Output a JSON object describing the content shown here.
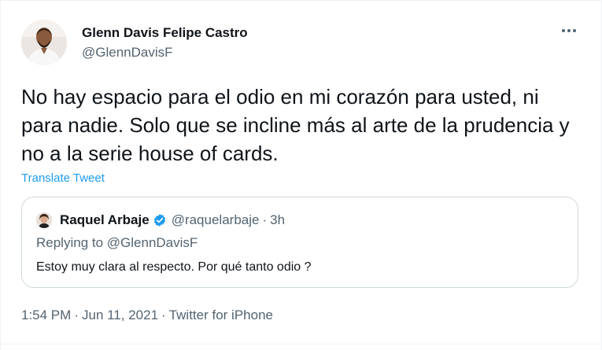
{
  "tweet": {
    "author_name": "Glenn Davis Felipe Castro",
    "author_handle": "@GlennDavisF",
    "more_icon": "more-dots-icon",
    "text": "No hay espacio para el odio en mi corazón para usted, ni para nadie. Solo que se incline más al arte de la prudencia y no a la serie house of cards.",
    "translate_label": "Translate Tweet",
    "time": "1:54 PM",
    "separator": "·",
    "date": "Jun 11, 2021",
    "source": "Twitter for iPhone"
  },
  "quote": {
    "author_name": "Raquel Arbaje",
    "verified_icon": "verified-badge-icon",
    "author_handle": "@raquelarbaje",
    "separator": "·",
    "time_ago": "3h",
    "replying_prefix": "Replying to ",
    "replying_to": "@GlennDavisF",
    "text": "Estoy muy clara al respecto. Por qué tanto odio ?"
  },
  "colors": {
    "text_primary": "#0f1419",
    "text_secondary": "#536471",
    "link_blue": "#1d9bf0",
    "border": "#cfd9de"
  }
}
